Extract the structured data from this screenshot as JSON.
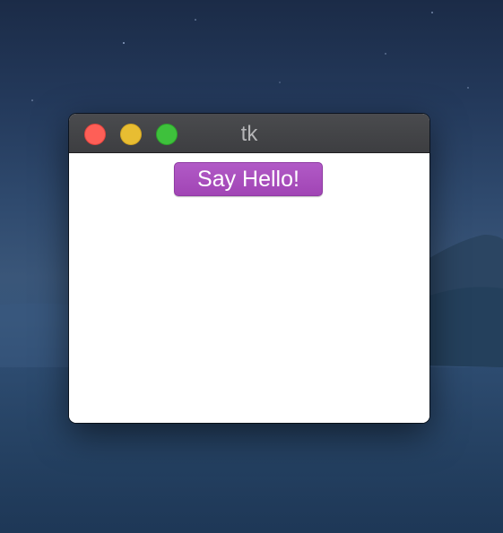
{
  "window": {
    "title": "tk"
  },
  "main": {
    "button_label": "Say Hello!"
  },
  "colors": {
    "button_accent": "#a94fbd",
    "titlebar": "#424346",
    "close": "#fe5f57",
    "minimize": "#e8bd32",
    "zoom": "#3ec13c"
  },
  "icons": {
    "close": "close-icon",
    "minimize": "minimize-icon",
    "zoom": "zoom-icon"
  }
}
